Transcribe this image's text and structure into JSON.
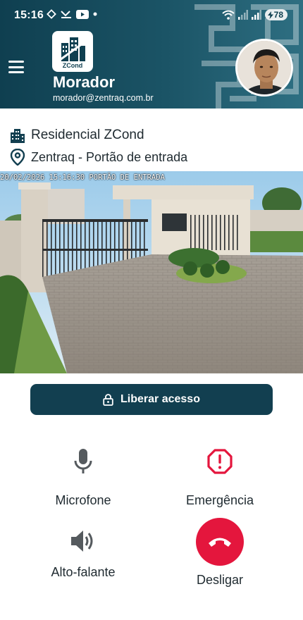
{
  "status_bar": {
    "time": "15:16",
    "battery": "78"
  },
  "header": {
    "logo_text": "ZCond",
    "role": "Morador",
    "email": "morador@zentraq.com.br"
  },
  "location": {
    "condominium": "Residencial ZCond",
    "gate": "Zentraq - Portão de entrada"
  },
  "camera": {
    "timestamp": "20/02/2026 15:16:30 PORTÃO DE ENTRADA"
  },
  "actions": {
    "release": "Liberar acesso",
    "microphone": "Microfone",
    "emergency": "Emergência",
    "speaker": "Alto-falante",
    "hangup": "Desligar"
  },
  "colors": {
    "header_primary": "#0f3f50",
    "button_primary": "#123f50",
    "emergency": "#e4163d",
    "hangup": "#e4163d",
    "icon_gray": "#555a5e"
  }
}
